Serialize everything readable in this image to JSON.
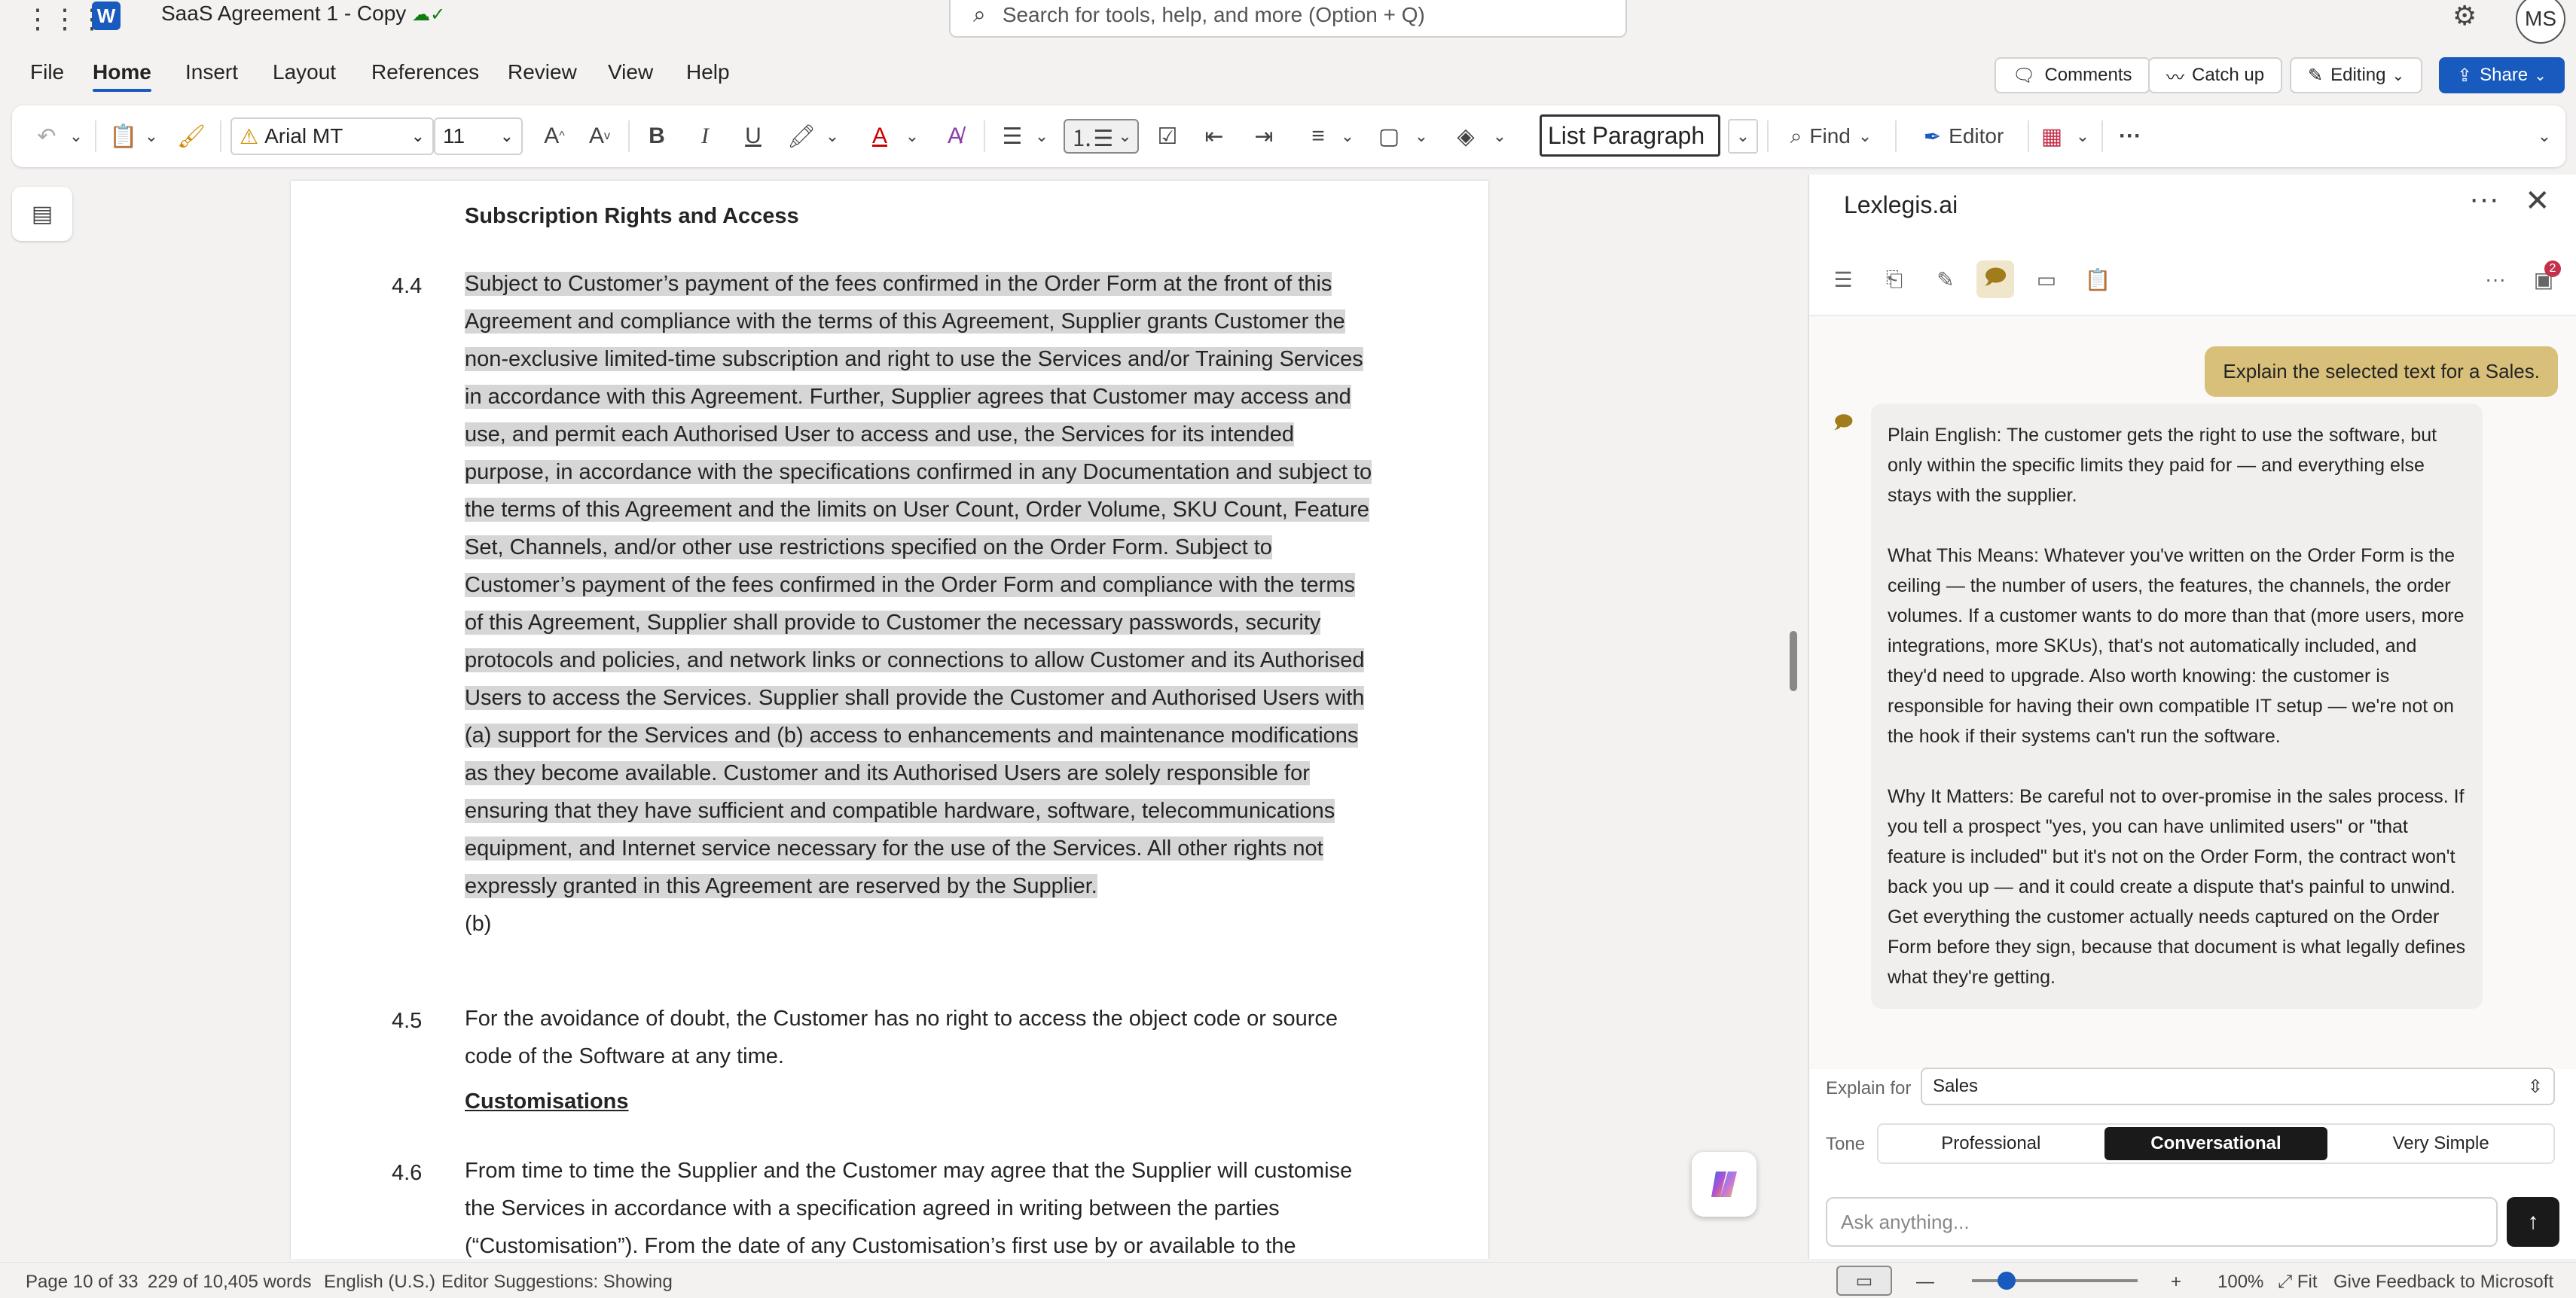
{
  "title_bar": {
    "doc_title": "SaaS Agreement 1 - Copy",
    "search_placeholder": "Search for tools, help, and more (Option + Q)",
    "user_initials": "MS"
  },
  "menu": {
    "items": [
      "File",
      "Home",
      "Insert",
      "Layout",
      "References",
      "Review",
      "View",
      "Help"
    ],
    "active": "Home"
  },
  "top_buttons": {
    "comments": "Comments",
    "catch_up": "Catch up",
    "editing": "Editing",
    "share": "Share"
  },
  "ribbon": {
    "font": "Arial MT",
    "size": "11",
    "style": "List Paragraph",
    "find": "Find",
    "editor": "Editor"
  },
  "document": {
    "heading1": "Subscription Rights and Access",
    "clause_44": {
      "num": "4.4",
      "lines": [
        "Subject to Customer’s payment of the fees confirmed in the Order Form at the front of this",
        "Agreement and compliance with the terms of this Agreement, Supplier grants Customer the",
        "non-exclusive limited-time subscription and right to use the Services and/or Training Services",
        "in accordance with this Agreement. Further, Supplier agrees that Customer may access and",
        "use, and permit each Authorised User to access and use, the Services for its intended",
        "purpose, in accordance with the specifications confirmed in any Documentation and subject to",
        "the terms of this Agreement and the limits on User Count, Order Volume, SKU Count, Feature",
        "Set, Channels, and/or other use restrictions specified on the Order Form. Subject to",
        "Customer’s payment of the fees confirmed in the Order Form and compliance with the terms",
        "of this Agreement, Supplier shall provide to Customer the necessary passwords, security",
        "protocols and policies, and network links or connections to allow Customer and its Authorised",
        "Users to access the Services. Supplier shall provide the Customer and Authorised Users with",
        "(a) support for the Services and (b) access to enhancements and maintenance modifications",
        "as they become available. Customer and its Authorised Users are solely responsible for",
        "ensuring that they have sufficient and compatible hardware, software, telecommunications",
        "equipment, and Internet service necessary for the use of the Services. All other rights not",
        "expressly granted in this Agreement are reserved by the Supplier."
      ],
      "trailing": "(b)"
    },
    "clause_45": {
      "num": "4.5",
      "lines": [
        "For the avoidance of doubt, the Customer has no right to access the object code or source",
        "code of the Software at any time."
      ]
    },
    "heading2": "Customisations",
    "clause_46": {
      "num": "4.6",
      "lines": [
        "From time to time the Supplier and the Customer may agree that the Supplier will customise",
        "the Services in accordance with a specification agreed in writing between the parties",
        "(“Customisation”). From the date of any Customisation’s first use by or available to the"
      ]
    }
  },
  "panel": {
    "title": "Lexlegis.ai",
    "badge": "2",
    "user_message": "Explain the selected text for a Sales.",
    "bot_paragraphs": [
      "Plain English: The customer gets the right to use the software, but only within the specific limits they paid for — and everything else stays with the supplier.",
      "What This Means: Whatever you've written on the Order Form is the ceiling — the number of users, the features, the channels, the order volumes. If a customer wants to do more than that (more users, more integrations, more SKUs), that's not automatically included, and they'd need to upgrade. Also worth knowing: the customer is responsible for having their own compatible IT setup — we're not on the hook if their systems can't run the software.",
      "Why It Matters: Be careful not to over-promise in the sales process. If you tell a prospect \"yes, you can have unlimited users\" or \"that feature is included\" but it's not on the Order Form, the contract won't back you up — and it could create a dispute that's painful to unwind. Get everything the customer actually needs captured on the Order Form before they sign, because that document is what legally defines what they're getting."
    ],
    "explain_for_label": "Explain for",
    "explain_for_value": "Sales",
    "tone_label": "Tone",
    "tones": [
      "Professional",
      "Conversational",
      "Very Simple"
    ],
    "active_tone": "Conversational",
    "ask_placeholder": "Ask anything..."
  },
  "status_bar": {
    "page": "Page 10 of 33",
    "words": "229 of 10,405 words",
    "language": "English (U.S.)",
    "editor": "Editor Suggestions: Showing",
    "zoom": "100%",
    "fit": "Fit",
    "feedback": "Give Feedback to Microsoft"
  }
}
